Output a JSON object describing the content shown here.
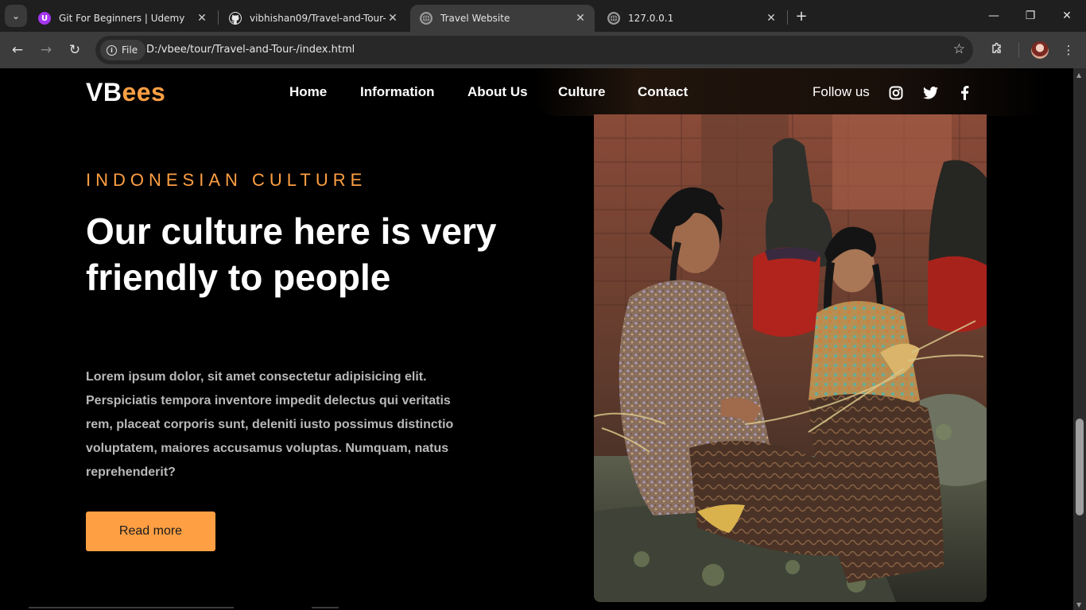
{
  "browser": {
    "tabs": [
      {
        "title": "Git For Beginners | Udemy",
        "favicon": "udemy-icon"
      },
      {
        "title": "vibhishan09/Travel-and-Tour-",
        "favicon": "github-icon"
      },
      {
        "title": "Travel Website",
        "favicon": "globe-icon",
        "active": true
      },
      {
        "title": "127.0.0.1",
        "favicon": "globe-icon"
      }
    ],
    "site_chip": "File",
    "url": "D:/vbee/tour/Travel-and-Tour-/index.html"
  },
  "site": {
    "logo": {
      "prefix": "VB",
      "accent": "ees"
    },
    "menu": [
      "Home",
      "Information",
      "About Us",
      "Culture",
      "Contact"
    ],
    "follow_label": "Follow us",
    "social_icons": [
      "instagram-icon",
      "twitter-icon",
      "facebook-icon"
    ]
  },
  "hero": {
    "eyebrow": "INDONESIAN CULTURE",
    "headline": "Our culture here is very friendly to people",
    "body": "Lorem ipsum dolor, sit amet consectetur adipisicing elit. Perspiciatis tempora inventore impedit delectus qui veritatis rem, placeat corporis sunt, deleniti iusto possimus distinctio voluptatem, maiores accusamus voluptas. Numquam, natus reprehenderit?",
    "button": "Read more"
  },
  "colors": {
    "accent": "#ff9f43",
    "background": "#000000",
    "text": "#ffffff",
    "muted_text": "#b9b9b9"
  }
}
